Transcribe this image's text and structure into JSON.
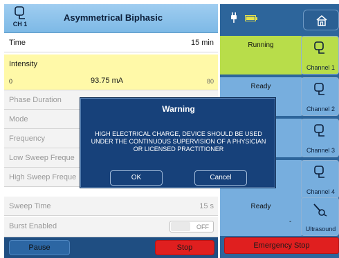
{
  "left": {
    "channel_label": "CH 1",
    "program_title": "Asymmetrical Biphasic",
    "time": {
      "label": "Time",
      "value": "15 min"
    },
    "intensity": {
      "label": "Intensity",
      "min": "0",
      "current": "93.75 mA",
      "max": "80"
    },
    "rows": [
      {
        "label": "Phase Duration",
        "value": ""
      },
      {
        "label": "Mode",
        "value": ""
      },
      {
        "label": "Frequency",
        "value": ""
      },
      {
        "label": "Low Sweep Freque",
        "value": ""
      },
      {
        "label": "High Sweep Freque",
        "value": ""
      },
      {
        "label": "Sweep Time",
        "value": "15 s"
      },
      {
        "label": "Burst Enabled",
        "value": ""
      }
    ],
    "burst_toggle_state": "OFF",
    "pause_label": "Pause",
    "stop_label": "Stop"
  },
  "right": {
    "home_icon": "home-icon",
    "channels": [
      {
        "status": "Running",
        "name": "Channel 1",
        "dash": "",
        "color": "#b8dd4a",
        "icon": "electrode-icon"
      },
      {
        "status": "Ready",
        "name": "Channel 2",
        "dash": "",
        "color": "#77aede",
        "icon": "electrode-icon"
      },
      {
        "status": "",
        "name": "Channel 3",
        "dash": "",
        "color": "#77aede",
        "icon": "electrode-icon"
      },
      {
        "status": "",
        "name": "Channel 4",
        "dash": "",
        "color": "#77aede",
        "icon": "electrode-icon"
      },
      {
        "status": "Ready",
        "name": "Ultrasound",
        "dash": "-",
        "color": "#77aede",
        "icon": "ultrasound-icon"
      }
    ],
    "emergency_stop_label": "Emergency Stop"
  },
  "modal": {
    "title": "Warning",
    "message": "HIGH ELECTRICAL CHARGE, DEVICE SHOULD BE USED UNDER THE CONTINUOUS SUPERVISION OF A PHYSICIAN OR LICENSED PRACTITIONER",
    "ok_label": "OK",
    "cancel_label": "Cancel"
  },
  "colors": {
    "header_blue": "#8cc3ec",
    "intensity_yellow": "#fff9a8",
    "dark_blue": "#1f4e82",
    "stop_red": "#e01f1f",
    "running_green": "#b8dd4a"
  }
}
